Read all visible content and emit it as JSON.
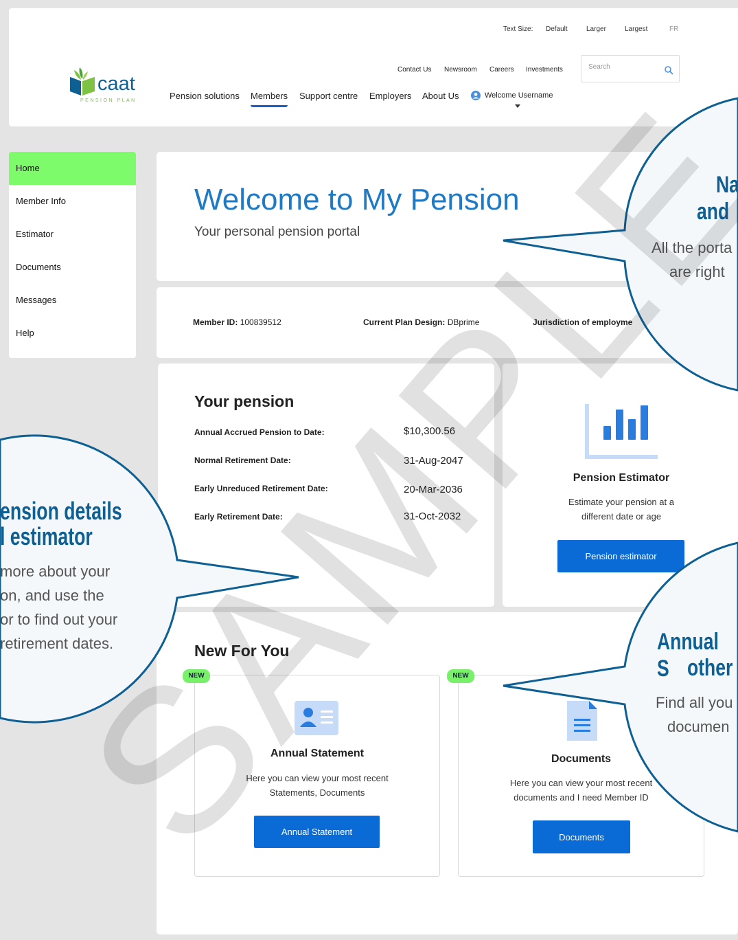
{
  "header": {
    "util": {
      "text_size_label": "Text Size:",
      "default": "Default",
      "larger": "Larger",
      "largest": "Largest",
      "lang": "FR"
    },
    "secondary_nav": [
      "Contact Us",
      "Newsroom",
      "Careers",
      "Investments"
    ],
    "search": {
      "placeholder": "Search"
    },
    "logo": {
      "name": "caat",
      "tagline": "PENSION PLAN"
    },
    "main_nav": [
      "Pension solutions",
      "Members",
      "Support centre",
      "Employers",
      "About Us"
    ],
    "active_nav": "Members",
    "user": {
      "label": "Welcome Username"
    }
  },
  "sidebar": {
    "items": [
      "Home",
      "Member Info",
      "Estimator",
      "Documents",
      "Messages",
      "Help"
    ],
    "active": "Home"
  },
  "welcome": {
    "title": "Welcome to My Pension",
    "subtitle": "Your personal pension portal"
  },
  "member_info": {
    "member_id_label": "Member ID:",
    "member_id": "100839512",
    "plan_label": "Current Plan Design:",
    "plan": "DBprime",
    "jurisdiction_label": "Jurisdiction of employme"
  },
  "pension": {
    "heading": "Your pension",
    "rows": [
      {
        "label": "Annual Accrued Pension to Date:",
        "value": "$10,300.56"
      },
      {
        "label": "Normal Retirement Date:",
        "value": "31-Aug-2047"
      },
      {
        "label": "Early Unreduced Retirement Date:",
        "value": "20-Mar-2036"
      },
      {
        "label": "Early Retirement Date:",
        "value": "31-Oct-2032"
      }
    ]
  },
  "estimator": {
    "title": "Pension Estimator",
    "desc1": "Estimate your pension at a",
    "desc2": "different date or age",
    "button": "Pension estimator"
  },
  "new_for_you": {
    "heading": "New For You",
    "badge": "NEW",
    "tiles": [
      {
        "title": "Annual Statement",
        "desc1": "Here you can view your most recent",
        "desc2": "Statements, Documents",
        "button": "Annual Statement"
      },
      {
        "title": "Documents",
        "desc1": "Here you can view your most recent",
        "desc2": "documents and I need Member ID",
        "button": "Documents"
      }
    ]
  },
  "callouts": {
    "top": {
      "h1": "Na",
      "h2": "and",
      "b1": "All the porta",
      "b2": "are right"
    },
    "left": {
      "h1": "ension details",
      "h2": "l estimator",
      "b1": "more about your",
      "b2": "on, and use the",
      "b3": "or to find out your",
      "b4": "retirement dates."
    },
    "right": {
      "h1": "Annual S",
      "h2": "other",
      "b1": "Find all you",
      "b2": "documen"
    }
  },
  "watermark": "SAMPLE",
  "colors": {
    "accent_blue": "#0a6bd6",
    "title_blue": "#1f7ac6",
    "active_green": "#7dfb6a",
    "badge_green": "#78f06a",
    "callout_border": "#0e5f92",
    "callout_fill": "#f4f8fb"
  }
}
